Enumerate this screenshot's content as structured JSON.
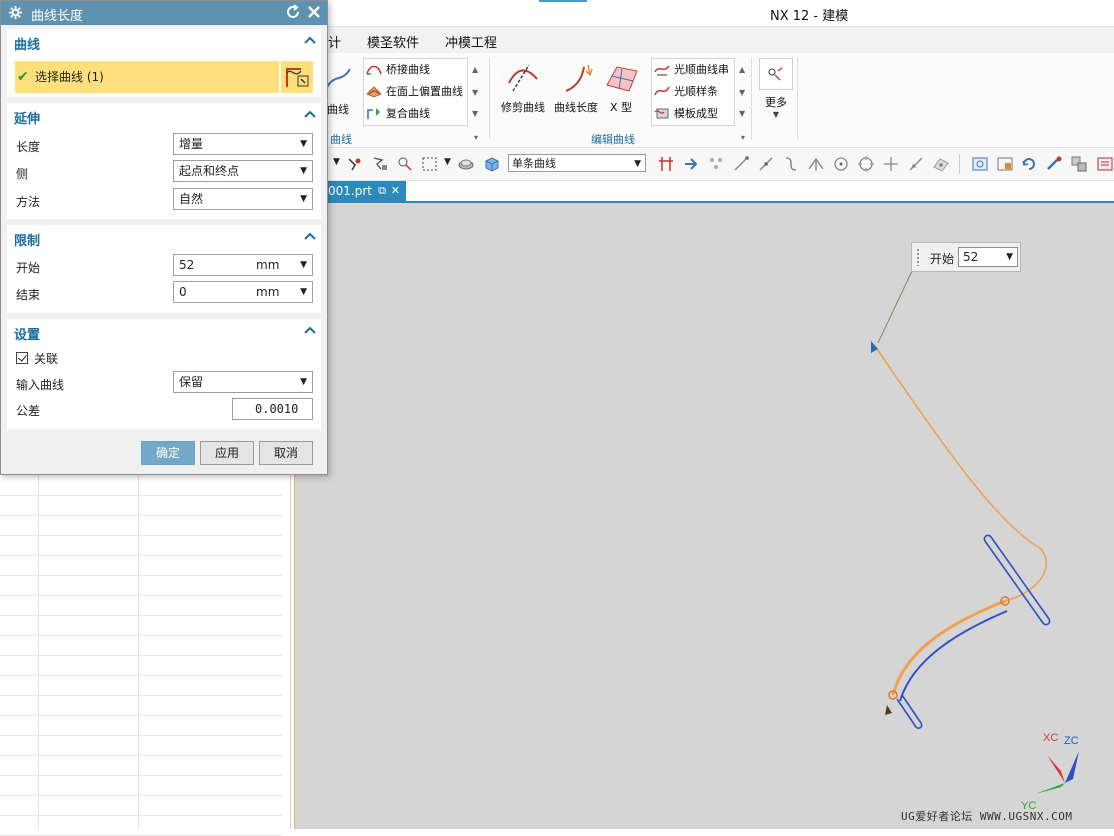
{
  "app": {
    "title": "NX 12 - 建模"
  },
  "menu": {
    "items": [
      "计",
      "模圣软件",
      "冲模工程"
    ]
  },
  "ribbon": {
    "left_cut_label": "曲线",
    "left_group_label": "曲线",
    "derived_items": [
      "桥接曲线",
      "在面上偏置曲线",
      "复合曲线"
    ],
    "edit_large": [
      "修剪曲线",
      "曲线长度",
      "X 型"
    ],
    "edit_items": [
      "光顺曲线串",
      "光顺样条",
      "模板成型"
    ],
    "edit_group_label": "编辑曲线",
    "more_label": "更多"
  },
  "toolbar": {
    "filter_value": "单条曲线"
  },
  "file_tab": {
    "label": "001.prt"
  },
  "viewport": {
    "start_popup": {
      "label": "开始",
      "value": "52"
    },
    "triad": {
      "x": "XC",
      "y": "YC",
      "z": "ZC"
    },
    "watermark": "UG爱好者论坛 WWW.UGSNX.COM"
  },
  "dialog": {
    "title": "曲线长度",
    "sections": {
      "curve": {
        "title": "曲线",
        "select_label": "选择曲线 (1)"
      },
      "extend": {
        "title": "延伸",
        "length_label": "长度",
        "length_value": "增量",
        "side_label": "侧",
        "side_value": "起点和终点",
        "method_label": "方法",
        "method_value": "自然"
      },
      "limits": {
        "title": "限制",
        "start_label": "开始",
        "start_value": "52",
        "start_unit": "mm",
        "end_label": "结束",
        "end_value": "0",
        "end_unit": "mm"
      },
      "settings": {
        "title": "设置",
        "associative_label": "关联",
        "associative_checked": true,
        "input_curve_label": "输入曲线",
        "input_curve_value": "保留",
        "tolerance_label": "公差",
        "tolerance_value": "0.0010"
      }
    },
    "buttons": {
      "ok": "确定",
      "apply": "应用",
      "cancel": "取消"
    }
  },
  "colors": {
    "accent": "#2b8ab9",
    "dialog_title_bg": "#5f91b0",
    "selection_highlight": "#ffdf7b",
    "curve_orange": "#f0a050",
    "curve_blue": "#2d50c8"
  }
}
